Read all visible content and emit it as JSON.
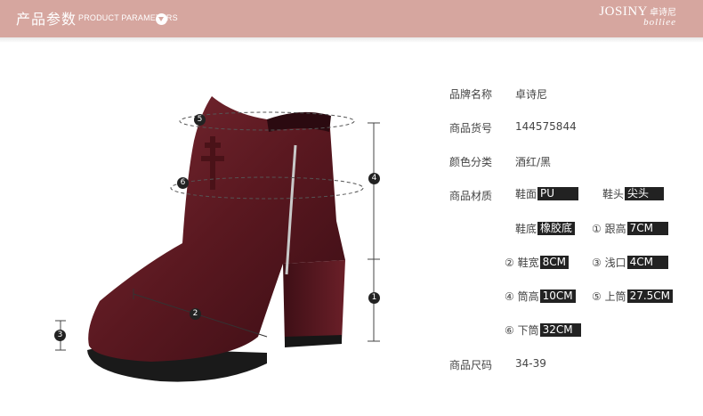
{
  "header": {
    "title": "产品参数",
    "subtitle": "PRODUCT PARAMETERS",
    "brand_name": "JOSINY",
    "brand_cn": "卓诗尼",
    "brand_signature": "bolliee"
  },
  "colors": {
    "header_bg": "#d6a69f",
    "value_bg": "#222222",
    "text": "#444444"
  },
  "product": {
    "measure_markers": [
      "1",
      "2",
      "3",
      "4",
      "5",
      "6"
    ],
    "params": {
      "brand": {
        "label": "品牌名称",
        "value": "卓诗尼"
      },
      "item_no": {
        "label": "商品货号",
        "value": "144575844"
      },
      "color": {
        "label": "颜色分类",
        "value": "酒红/黑"
      },
      "material": {
        "label": "商品材质"
      },
      "upper": {
        "label": "鞋面",
        "value": "PU"
      },
      "toe": {
        "label": "鞋头",
        "value": "尖头"
      },
      "sole": {
        "label": "鞋底",
        "value": "橡胶底"
      },
      "heel_height": {
        "label": "① 跟高",
        "value": "7CM"
      },
      "width": {
        "label": "② 鞋宽",
        "value": "8CM"
      },
      "shallow": {
        "label": "③ 浅口",
        "value": "4CM"
      },
      "shaft_height": {
        "label": "④ 筒高",
        "value": "10CM"
      },
      "upper_circ": {
        "label": "⑤ 上筒",
        "value": "27.5CM"
      },
      "lower_circ": {
        "label": "⑥ 下筒",
        "value": "32CM"
      },
      "size": {
        "label": "商品尺码",
        "value": "34-39"
      }
    }
  }
}
